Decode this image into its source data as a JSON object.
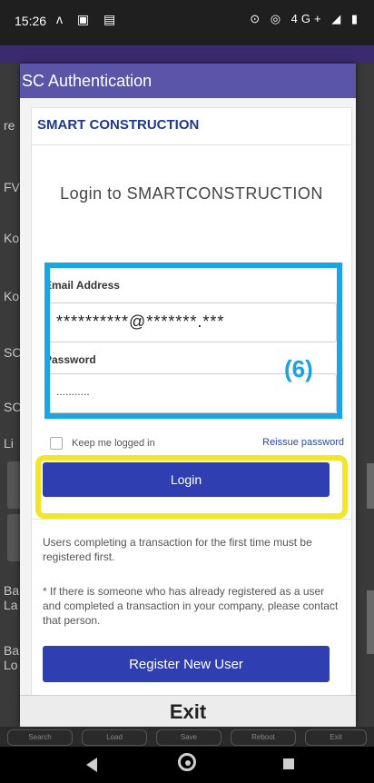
{
  "status_bar": {
    "time": "15:26",
    "left_icons": "ᴧ ▣ ▤",
    "right_icons": "⊙ ◎ 4G+ ◢ ▮"
  },
  "dialog": {
    "title": "SC Authentication",
    "brand": "SMART CONSTRUCTION",
    "heading": "Login to SMARTCONSTRUCTION",
    "email_label": "Email Address",
    "email_value": "**********@*******.***",
    "password_label": "Password",
    "password_value": "...........",
    "annotation_label": "(6)",
    "remember_label": "Keep me logged in",
    "reissue_label": "Reissue password",
    "login_label": "Login",
    "info_1": "Users completing a transaction for the first time must be registered first.",
    "info_2": "* If there is someone who has already registered as a user and completed a transaction in your company, please contact that person.",
    "register_label": "Register New User",
    "exit_label": "Exit"
  },
  "background_app": {
    "side_labels": [
      "re",
      "FV",
      "Ko",
      "Ko",
      "SC",
      "SC",
      "Li",
      "Ba La",
      "Ba Lo"
    ],
    "toolbar_labels": [
      "Search",
      "Load",
      "Save",
      "Reboot",
      "Exit"
    ]
  },
  "colors": {
    "annotation_blue": "#19a6e6",
    "annotation_yellow": "#f2e52a",
    "primary_button": "#2f3eb1",
    "brand": "#1d3a8a"
  }
}
